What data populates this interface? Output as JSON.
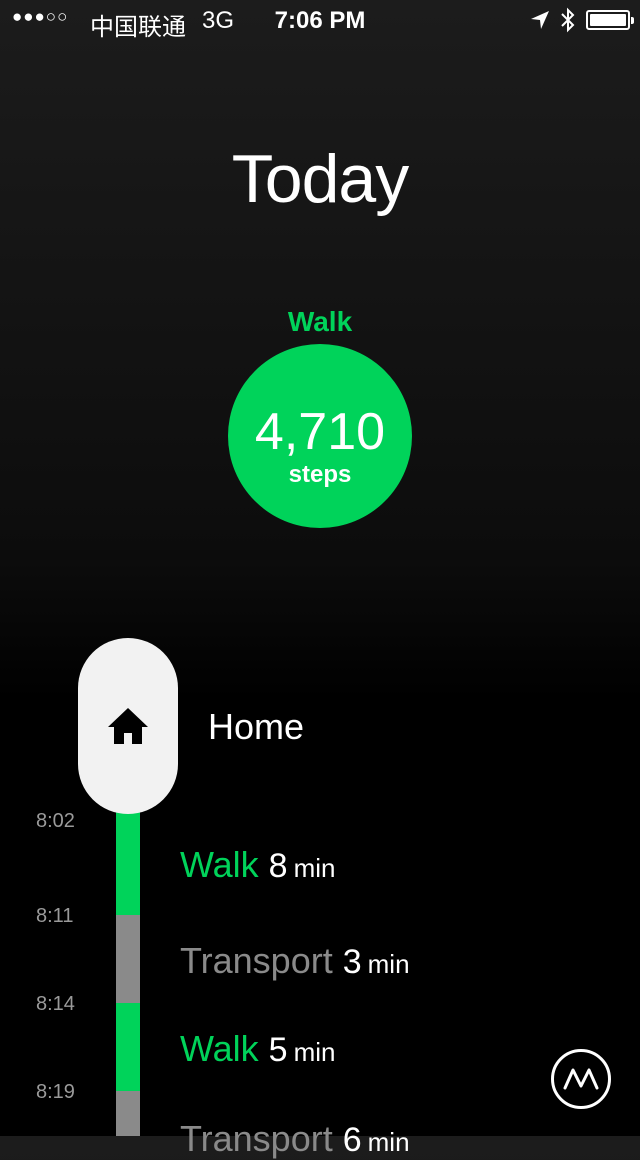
{
  "status_bar": {
    "signal": "●●●○○",
    "carrier": "中国联通",
    "network": "3G",
    "time": "7:06 PM",
    "battery_level": 1.0
  },
  "header": {
    "title": "Today"
  },
  "summary": {
    "activity": "Walk",
    "steps": "4,710",
    "unit": "steps",
    "color": "#00d35a"
  },
  "timeline": {
    "place": {
      "name": "Home",
      "icon": "home-icon"
    },
    "times": [
      "8:02",
      "8:11",
      "8:14",
      "8:19"
    ],
    "entries": [
      {
        "type": "Walk",
        "duration": "8",
        "unit": "min"
      },
      {
        "type": "Transport",
        "duration": "3",
        "unit": "min"
      },
      {
        "type": "Walk",
        "duration": "5",
        "unit": "min"
      },
      {
        "type": "Transport",
        "duration": "6",
        "unit": "min"
      }
    ],
    "colors": {
      "walk": "#00d35a",
      "transport": "#8a8a8a"
    }
  },
  "fab": {
    "icon": "moves-logo-icon"
  }
}
